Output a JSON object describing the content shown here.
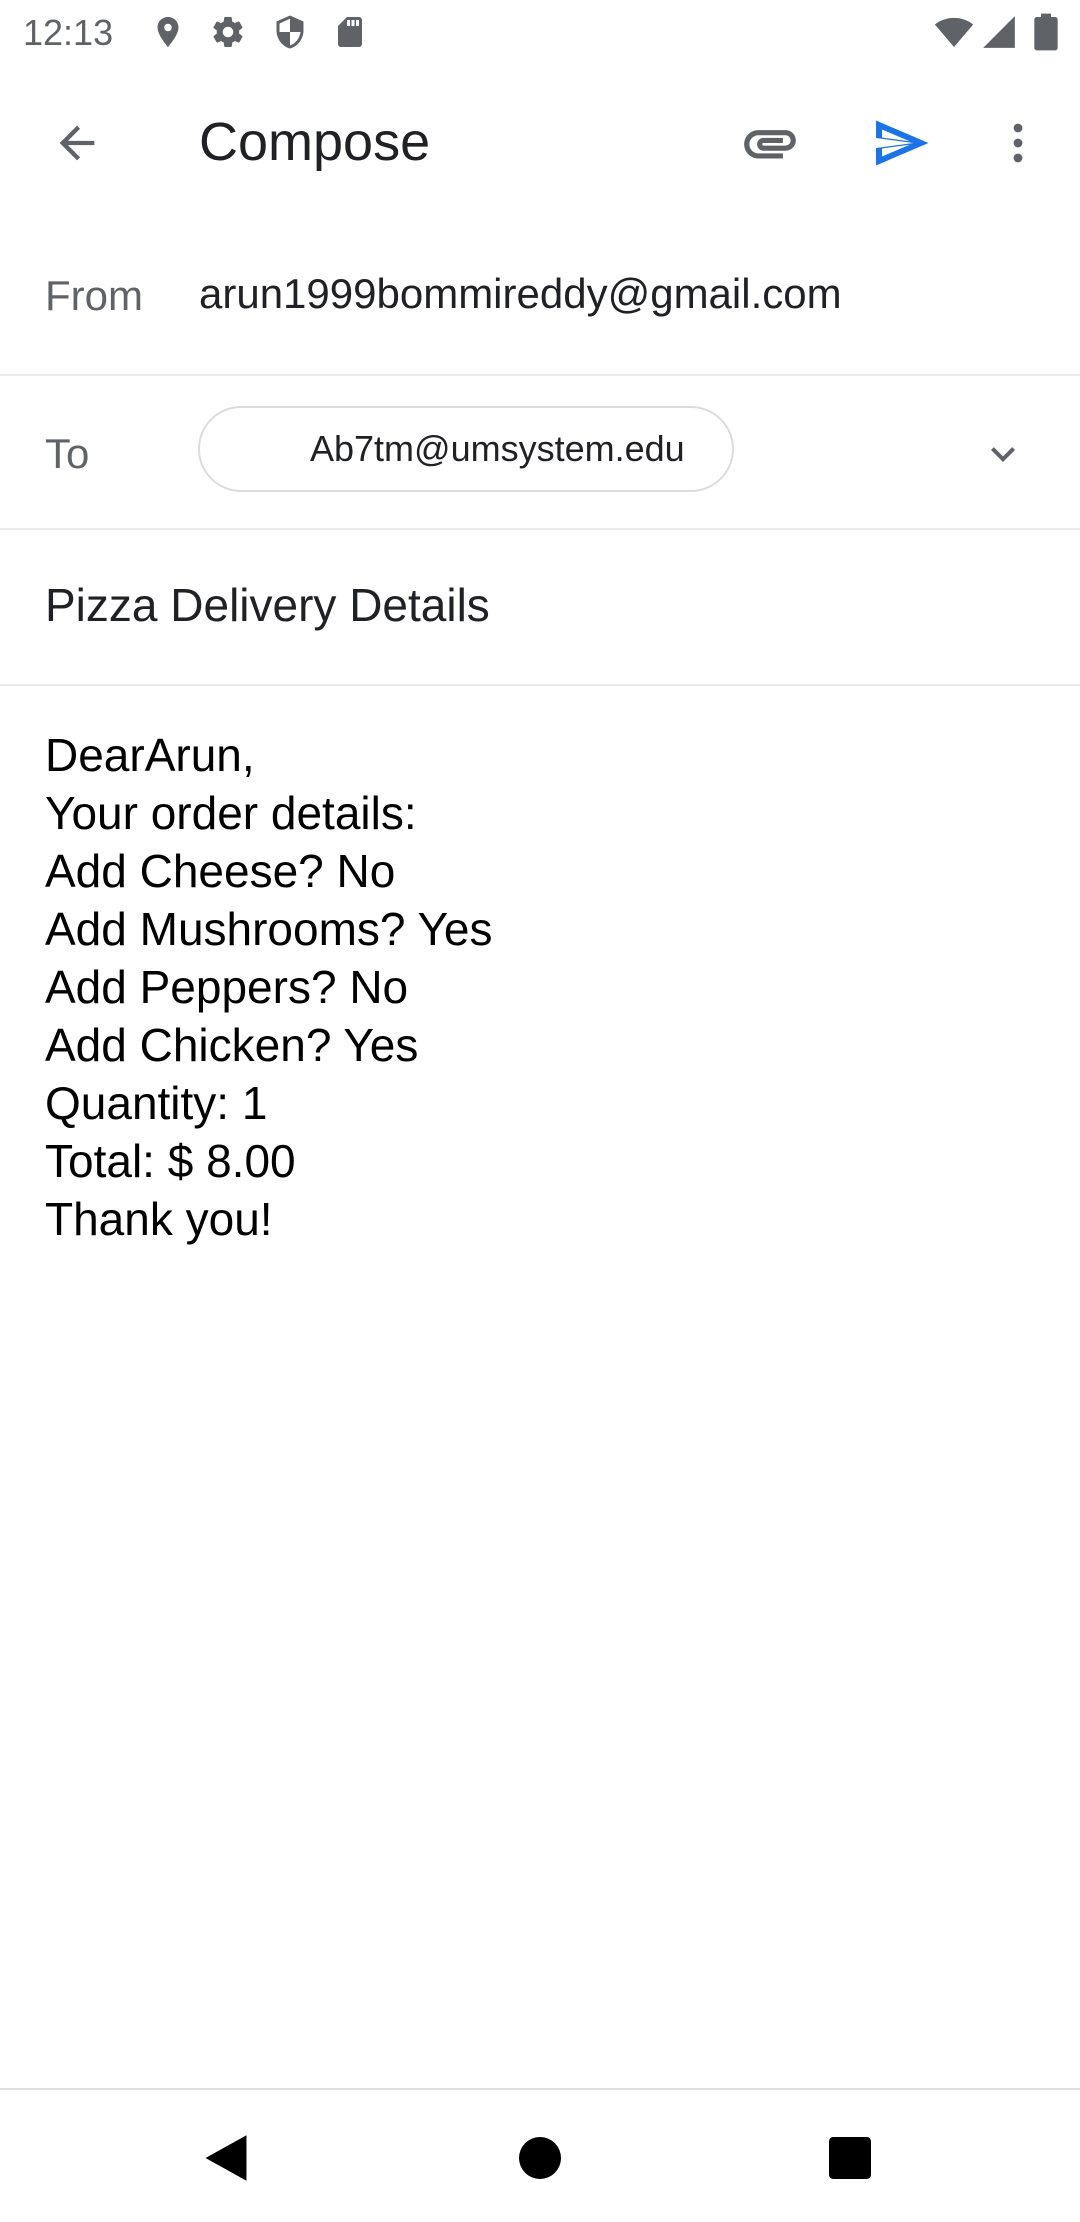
{
  "status_bar": {
    "time": "12:13",
    "left_icons": [
      "location-icon",
      "settings-icon",
      "shield-icon",
      "sd-card-icon"
    ],
    "right_icons": [
      "wifi-icon",
      "cell-signal-icon",
      "battery-icon"
    ]
  },
  "app_bar": {
    "title": "Compose",
    "back_icon": "arrow-back-icon",
    "attach_icon": "paperclip-icon",
    "send_icon": "send-icon",
    "more_icon": "more-vert-icon",
    "accent_color": "#1a73e8"
  },
  "from": {
    "label": "From",
    "value": "arun1999bommireddy@gmail.com"
  },
  "to": {
    "label": "To",
    "recipient": "Ab7tm@umsystem.edu",
    "expand_icon": "chevron-down-icon"
  },
  "subject": {
    "value": "Pizza Delivery Details"
  },
  "body": {
    "lines": [
      "DearArun,",
      "Your order details:",
      "Add Cheese? No",
      "Add Mushrooms? Yes",
      "Add Peppers? No",
      "Add Chicken? Yes",
      "Quantity: 1",
      "Total: $ 8.00",
      "Thank you!"
    ]
  },
  "nav_bar": {
    "back_icon": "nav-back-icon",
    "home_icon": "nav-home-icon",
    "recents_icon": "nav-recents-icon"
  }
}
